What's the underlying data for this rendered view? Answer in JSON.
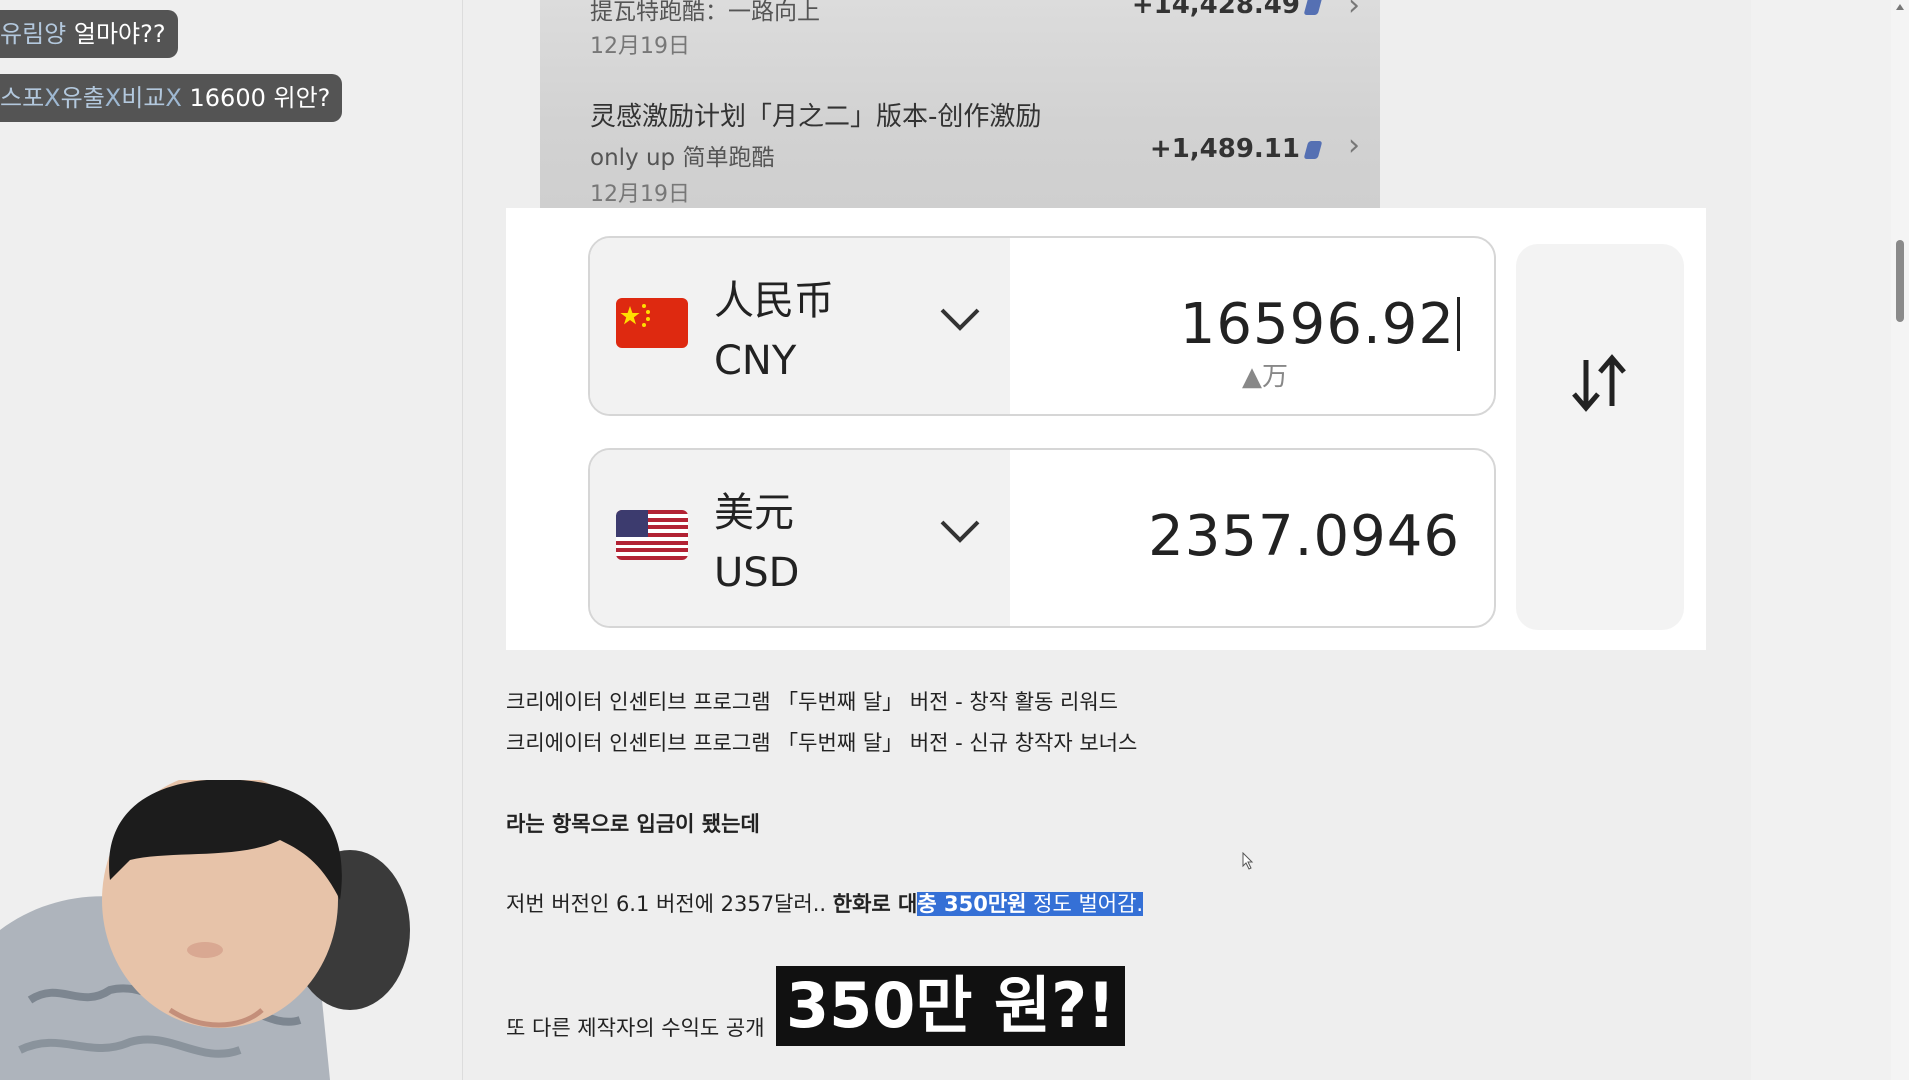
{
  "chat": [
    {
      "user": "유림양",
      "message": "얼마야??"
    },
    {
      "user_parts": [
        "스포",
        "유출",
        "비교",
        ""
      ],
      "message": "16600 위안?"
    }
  ],
  "embedded_screenshot": {
    "row1": {
      "subtitle": "提瓦特跑酷：一路向上",
      "amount": "+14,428.49",
      "date": "12月19日"
    },
    "row2": {
      "title": "灵感激励计划「月之二」版本-创作激励",
      "subtitle": "only up 简单跑酷",
      "amount": "+1,489.11",
      "date": "12月19日"
    },
    "converter": {
      "from": {
        "name": "人民币",
        "code": "CNY",
        "value": "16596.92",
        "unit_hint": "▲万"
      },
      "to": {
        "name": "美元",
        "code": "USD",
        "value": "2357.0946"
      },
      "swap_icon": "⇅"
    }
  },
  "article": {
    "line1": "크리에이터 인센티브 프로그램 「두번째 달」 버전 - 창작 활동 리워드",
    "line2": "크리에이터 인센티브 프로그램 「두번째 달」 버전 - 신규 창작자 보너스",
    "line3": "라는 항목으로 입금이 됐는데",
    "line4_prefix": "저번 버전인 6.1 버전에 2357달러.. ",
    "line4_bold": "한화로 대",
    "line4_hl_bold": "충 350만원",
    "line4_hl": " 정도 벌어감.",
    "line5": "또 다른 제작자의 수익도 공개"
  },
  "caption": "350만 원?!",
  "colors": {
    "highlight": "#3570d6",
    "chat_bubble": "#2d2d2d"
  }
}
